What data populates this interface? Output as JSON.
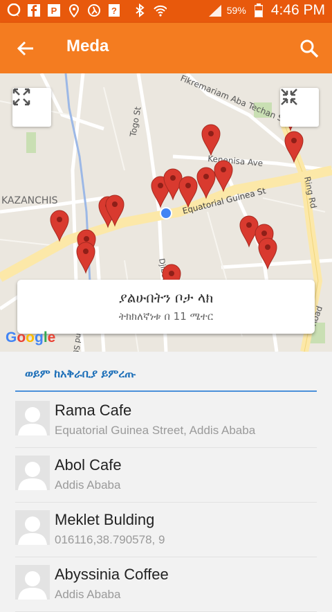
{
  "status": {
    "battery": "59%",
    "time": "4:46 PM",
    "icons": [
      "chat-icon",
      "facebook-icon",
      "p-icon",
      "location-icon",
      "runner-icon",
      "question-icon",
      "bluetooth-icon",
      "wifi-icon",
      "signal-icon",
      "battery-icon"
    ]
  },
  "appbar": {
    "title": "Meda"
  },
  "map": {
    "streets": [
      "Fikremariam Aba Techan St",
      "Togo St",
      "Kenenisa Ave",
      "Equatorial Guinea St",
      "Ring Rd",
      "KAZANCHIS",
      "Djibouti St",
      "Mickey Leland St",
      "Road"
    ],
    "attribution": "Google",
    "location_box": {
      "title": "ያልሁበትን ቦታ ላክ",
      "subtitle": "ትክክለኛነቱ በ 11 ሜተር"
    }
  },
  "section": {
    "title": "ወይም ከአቅራቢያ ይምረጡ"
  },
  "places": [
    {
      "name": "Rama Cafe",
      "address": "Equatorial Guinea Street, Addis Ababa"
    },
    {
      "name": "Abol Cafe",
      "address": "Addis Ababa"
    },
    {
      "name": "Meklet Bulding",
      "address": "016116,38.790578, 9"
    },
    {
      "name": "Abyssinia Coffee",
      "address": "Addis Ababa"
    }
  ],
  "colors": {
    "statusbar": "#e8590c",
    "appbar": "#f47c20",
    "accent": "#1d6fb8",
    "pin": "#d93a2f"
  }
}
